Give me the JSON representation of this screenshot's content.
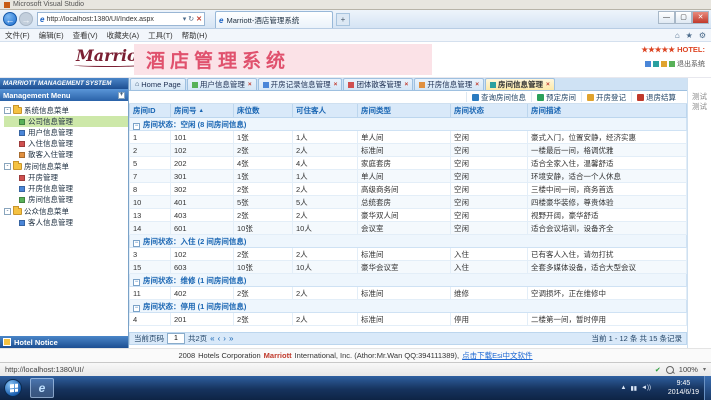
{
  "background_window": {
    "title": "Microsoft Visual Studio"
  },
  "browser": {
    "url": "http://localhost:1380/UI/Index.aspx",
    "tab_title": "Marriott-酒店管理系统",
    "menu_items": [
      "文件(F)",
      "编辑(E)",
      "查看(V)",
      "收藏夹(A)",
      "工具(T)",
      "帮助(H)"
    ],
    "status_url": "http://localhost:1380/UI/",
    "zoom": "100%"
  },
  "icons": {
    "back": "←",
    "forward": "→",
    "dropdown": "▾",
    "refresh": "↻",
    "stop": "✕",
    "minimize": "—",
    "maximize": "▢",
    "close": "✕",
    "home": "⌂",
    "star": "★",
    "gear": "⚙",
    "check": "✔",
    "new_tab": "+",
    "ie": "e"
  },
  "header": {
    "logo": "Marriott",
    "title": "酒店管理系统",
    "stars": "★★★★★",
    "hotel_label": "HOTEL:",
    "logout": "退出系统"
  },
  "sidebar": {
    "title": "MARRIOTT MANAGEMENT SYSTEM",
    "menu_header": "Management Menu",
    "groups": [
      {
        "label": "系统信息菜单",
        "items": [
          {
            "label": "公司信息管理",
            "selected": true,
            "icon_color": "#58b158"
          },
          {
            "label": "用户信息管理",
            "selected": false,
            "icon_color": "#4a86d8"
          },
          {
            "label": "入住信息管理",
            "selected": false,
            "icon_color": "#d05050"
          },
          {
            "label": "散客入住管理",
            "selected": false,
            "icon_color": "#e09040"
          }
        ]
      },
      {
        "label": "房间信息菜单",
        "items": [
          {
            "label": "开房管理",
            "selected": false,
            "icon_color": "#d05050"
          },
          {
            "label": "开房信息管理",
            "selected": false,
            "icon_color": "#4a86d8"
          },
          {
            "label": "房间信息管理",
            "selected": false,
            "icon_color": "#58b158"
          }
        ]
      },
      {
        "label": "公众信息菜单",
        "items": [
          {
            "label": "客人信息管理",
            "selected": false,
            "icon_color": "#4a86d8"
          }
        ]
      }
    ],
    "notice": "Hotel Notice"
  },
  "main": {
    "tabs": [
      {
        "label": "Home Page",
        "icon": "home-icon",
        "icon_color": "#4a86d8",
        "closable": false,
        "active": false
      },
      {
        "label": "用户信息管理",
        "icon": "page-icon",
        "icon_color": "#58b158",
        "closable": true,
        "active": false
      },
      {
        "label": "开房记录信息管理",
        "icon": "page-icon",
        "icon_color": "#4a86d8",
        "closable": true,
        "active": false
      },
      {
        "label": "团体散客管理",
        "icon": "page-icon",
        "icon_color": "#d05050",
        "closable": true,
        "active": false
      },
      {
        "label": "开房信息管理",
        "icon": "page-icon",
        "icon_color": "#e09040",
        "closable": true,
        "active": false
      },
      {
        "label": "房间信息管理",
        "icon": "page-icon",
        "icon_color": "#2aa0a0",
        "closable": true,
        "active": true
      }
    ],
    "toolbar": [
      {
        "label": "查询房间信息",
        "icon": "search-icon",
        "color": "#2a7bc0"
      },
      {
        "label": "预定房间",
        "icon": "calendar-icon",
        "color": "#2aa05a"
      },
      {
        "label": "开房登记",
        "icon": "key-icon",
        "color": "#e0a32e"
      },
      {
        "label": "退房结算",
        "icon": "checkout-icon",
        "color": "#c0392b"
      }
    ]
  },
  "table": {
    "headers": [
      "房间ID",
      "房间号",
      "床位数",
      "可住客人",
      "房间类型",
      "房间状态",
      "房间描述"
    ],
    "sort_col": 1,
    "groups": [
      {
        "label": "房间状态：空闲 (8 间房间信息)",
        "rows": [
          [
            "1",
            "101",
            "1张",
            "1人",
            "单人间",
            "空闲",
            "豪式入门，位置安静，经济实惠"
          ],
          [
            "2",
            "102",
            "2张",
            "2人",
            "标准间",
            "空闲",
            "一楼最后一间，格调优雅"
          ],
          [
            "5",
            "202",
            "4张",
            "4人",
            "家庭套房",
            "空闲",
            "适合全家入住，温馨舒适"
          ],
          [
            "7",
            "301",
            "1张",
            "1人",
            "单人间",
            "空闲",
            "环境安静，适合一个人休息"
          ],
          [
            "8",
            "302",
            "2张",
            "2人",
            "高级商务间",
            "空闲",
            "三楼中间一间，商务首选"
          ],
          [
            "10",
            "401",
            "5张",
            "5人",
            "总统套房",
            "空闲",
            "四楼豪华装修，尊贵体验"
          ],
          [
            "13",
            "403",
            "2张",
            "2人",
            "豪华双人间",
            "空闲",
            "视野开阔，豪华舒适"
          ],
          [
            "14",
            "601",
            "10张",
            "10人",
            "会议室",
            "空闲",
            "适合会议培训，设备齐全"
          ]
        ]
      },
      {
        "label": "房间状态：入住 (2 间房间信息)",
        "rows": [
          [
            "3",
            "102",
            "2张",
            "2人",
            "标准间",
            "入住",
            "已有客人入住，请勿打扰"
          ],
          [
            "15",
            "603",
            "10张",
            "10人",
            "豪华会议室",
            "入住",
            "全套多媒体设备，适合大型会议"
          ]
        ]
      },
      {
        "label": "房间状态：维修 (1 间房间信息)",
        "rows": [
          [
            "11",
            "402",
            "2张",
            "2人",
            "标准间",
            "维修",
            "空调损坏，正在维修中"
          ]
        ]
      },
      {
        "label": "房间状态：停用 (1 间房间信息)",
        "rows": [
          [
            "4",
            "201",
            "2张",
            "2人",
            "标准间",
            "停用",
            "二楼第一间，暂时停用"
          ]
        ]
      }
    ]
  },
  "pagination": {
    "prefix": "当前页码",
    "page": "1",
    "pages": "共2页",
    "summary": "当前 1 - 12 条 共 15 条记录"
  },
  "right_panel": {
    "labels": [
      "测试",
      "测试"
    ]
  },
  "footer": {
    "year": "2008",
    "pre": "Hotels Corporation",
    "brand": "Marriott",
    "post": "International, Inc. (Athor:Mr.Wan QQ:394111389),",
    "link": "点击下载Esi中文软件"
  },
  "taskbar": {
    "time": "9:45",
    "date": "2014/6/19"
  }
}
